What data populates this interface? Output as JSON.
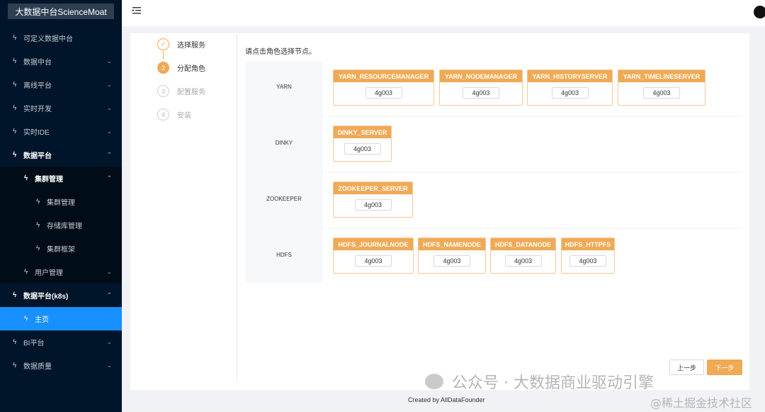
{
  "sidebar": {
    "brand": "大数据中台ScienceMoat",
    "items": [
      {
        "label": "可定义数据中台",
        "arrow": ""
      },
      {
        "label": "数据中台",
        "arrow": "⌄"
      },
      {
        "label": "离线平台",
        "arrow": "⌄"
      },
      {
        "label": "实时开发",
        "arrow": "⌄"
      },
      {
        "label": "实时IDE",
        "arrow": "⌄"
      },
      {
        "label": "数据平台",
        "arrow": "⌃"
      },
      {
        "label": "集群管理",
        "arrow": "⌃"
      },
      {
        "label": "集群管理",
        "arrow": ""
      },
      {
        "label": "存储库管理",
        "arrow": ""
      },
      {
        "label": "集群框架",
        "arrow": ""
      },
      {
        "label": "用户管理",
        "arrow": "⌄"
      },
      {
        "label": "数据平台(k8s)",
        "arrow": "⌃"
      },
      {
        "label": "主页",
        "arrow": ""
      },
      {
        "label": "BI平台",
        "arrow": "⌄"
      },
      {
        "label": "数据质量",
        "arrow": "⌄"
      }
    ]
  },
  "steps": [
    {
      "num": "✓",
      "label": "选择服务",
      "state": "done"
    },
    {
      "num": "2",
      "label": "分配角色",
      "state": "cur"
    },
    {
      "num": "3",
      "label": "配置服务",
      "state": "wait"
    },
    {
      "num": "4",
      "label": "安装",
      "state": "wait"
    }
  ],
  "hint": "请点击角色选择节点。",
  "groups": [
    {
      "name": "YARN",
      "roles": [
        {
          "name": "YARN_RESOURCEMANAGER",
          "node": "4g003"
        },
        {
          "name": "YARN_NODEMANAGER",
          "node": "4g003"
        },
        {
          "name": "YARN_HISTORYSERVER",
          "node": "4g003"
        },
        {
          "name": "YARN_TIMELINESERVER",
          "node": "4g003"
        }
      ]
    },
    {
      "name": "DINKY",
      "roles": [
        {
          "name": "DINKY_SERVER",
          "node": "4g003"
        }
      ]
    },
    {
      "name": "ZOOKEEPER",
      "roles": [
        {
          "name": "ZOOKEEPER_SERVER",
          "node": "4g003"
        }
      ]
    },
    {
      "name": "HDFS",
      "roles": [
        {
          "name": "HDFS_JOURNALNODE",
          "node": "4g003"
        },
        {
          "name": "HDFS_NAMENODE",
          "node": "4g003"
        },
        {
          "name": "HDFS_DATANODE",
          "node": "4g003"
        },
        {
          "name": "HDFS_HTTPFS",
          "node": "4g003"
        }
      ]
    }
  ],
  "buttons": {
    "prev": "上一步",
    "next": "下一步"
  },
  "footer": "Created by AllDataFounder",
  "watermark": {
    "main": "公众号 · 大数据商业驱动引擎",
    "corner": "@稀土掘金技术社区"
  },
  "colors": {
    "accent": "#f0a955",
    "sidebar": "#001529",
    "active": "#1890ff"
  }
}
